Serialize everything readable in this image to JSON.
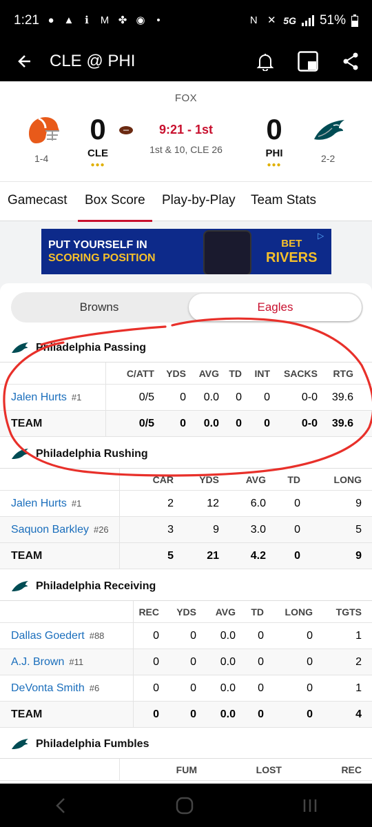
{
  "status_bar": {
    "time": "1:21",
    "network": "5G",
    "battery": "51%"
  },
  "app_bar": {
    "title": "CLE @ PHI"
  },
  "scoreboard": {
    "network": "FOX",
    "away": {
      "abbr": "CLE",
      "score": "0",
      "record": "1-4"
    },
    "home": {
      "abbr": "PHI",
      "score": "0",
      "record": "2-2"
    },
    "clock": "9:21 - 1st",
    "down_distance": "1st & 10, CLE 26"
  },
  "tabs": [
    "Gamecast",
    "Box Score",
    "Play-by-Play",
    "Team Stats"
  ],
  "ad": {
    "line1": "PUT YOURSELF IN",
    "line2": "SCORING POSITION",
    "brand1": "BET",
    "brand2": "RIVERS"
  },
  "team_toggle": {
    "away": "Browns",
    "home": "Eagles"
  },
  "passing": {
    "title": "Philadelphia Passing",
    "headers": [
      "C/ATT",
      "YDS",
      "AVG",
      "TD",
      "INT",
      "SACKS",
      "RTG"
    ],
    "rows": [
      {
        "name": "Jalen Hurts",
        "num": "#1",
        "stats": [
          "0/5",
          "0",
          "0.0",
          "0",
          "0",
          "0-0",
          "39.6"
        ]
      }
    ],
    "team": {
      "name": "TEAM",
      "stats": [
        "0/5",
        "0",
        "0.0",
        "0",
        "0",
        "0-0",
        "39.6"
      ]
    }
  },
  "rushing": {
    "title": "Philadelphia Rushing",
    "headers": [
      "CAR",
      "YDS",
      "AVG",
      "TD",
      "LONG"
    ],
    "rows": [
      {
        "name": "Jalen Hurts",
        "num": "#1",
        "stats": [
          "2",
          "12",
          "6.0",
          "0",
          "9"
        ]
      },
      {
        "name": "Saquon Barkley",
        "num": "#26",
        "stats": [
          "3",
          "9",
          "3.0",
          "0",
          "5"
        ]
      }
    ],
    "team": {
      "name": "TEAM",
      "stats": [
        "5",
        "21",
        "4.2",
        "0",
        "9"
      ]
    }
  },
  "receiving": {
    "title": "Philadelphia Receiving",
    "headers": [
      "REC",
      "YDS",
      "AVG",
      "TD",
      "LONG",
      "TGTS"
    ],
    "rows": [
      {
        "name": "Dallas Goedert",
        "num": "#88",
        "stats": [
          "0",
          "0",
          "0.0",
          "0",
          "0",
          "1"
        ]
      },
      {
        "name": "A.J. Brown",
        "num": "#11",
        "stats": [
          "0",
          "0",
          "0.0",
          "0",
          "0",
          "2"
        ]
      },
      {
        "name": "DeVonta Smith",
        "num": "#6",
        "stats": [
          "0",
          "0",
          "0.0",
          "0",
          "0",
          "1"
        ]
      }
    ],
    "team": {
      "name": "TEAM",
      "stats": [
        "0",
        "0",
        "0.0",
        "0",
        "0",
        "4"
      ]
    }
  },
  "fumbles": {
    "title": "Philadelphia Fumbles",
    "headers": [
      "FUM",
      "LOST",
      "REC"
    ]
  },
  "colors": {
    "accent": "#c8102e",
    "link": "#1a6ebc",
    "annotation": "#e8302a"
  }
}
